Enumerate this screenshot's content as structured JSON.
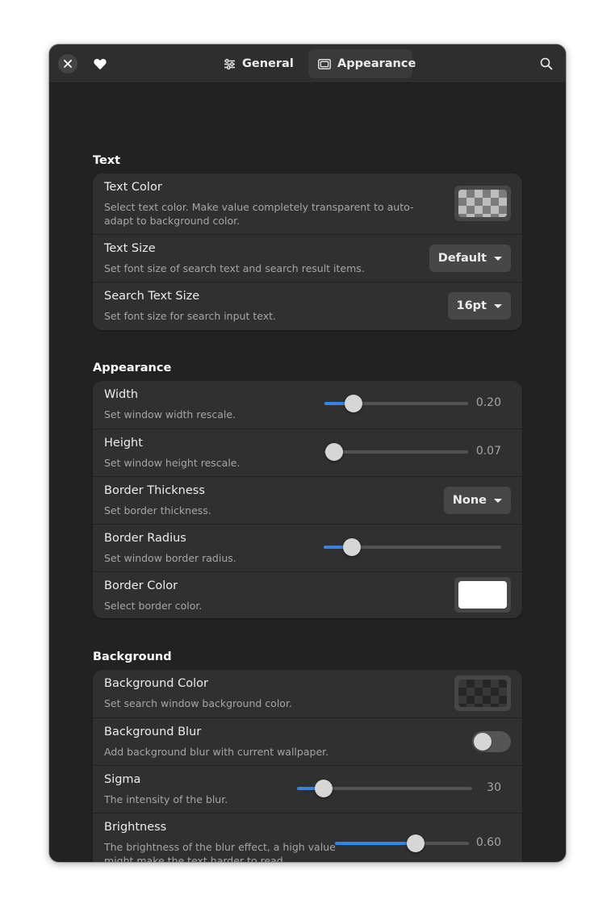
{
  "header": {
    "tabs": [
      {
        "label": "General",
        "icon": "sliders-icon",
        "active": false
      },
      {
        "label": "Appearance",
        "icon": "window-icon",
        "active": true
      }
    ],
    "close_icon": "close-icon",
    "favorite_icon": "heart-icon",
    "search_icon": "search-icon"
  },
  "text_section": {
    "title": "Text",
    "rows": [
      {
        "title": "Text Color",
        "subtitle": "Select text color. Make value completely transparent to auto-adapt to background color.",
        "swatch": "transparent"
      },
      {
        "title": "Text Size",
        "subtitle": "Set font size of search text and search result items.",
        "value": "Default"
      },
      {
        "title": "Search Text Size",
        "subtitle": "Set font size for search input text.",
        "value": "16pt"
      }
    ]
  },
  "appearance_section": {
    "title": "Appearance",
    "rows": [
      {
        "title": "Width",
        "subtitle": "Set window width rescale.",
        "value_label": "0.20",
        "fraction": 0.2
      },
      {
        "title": "Height",
        "subtitle": "Set window height rescale.",
        "value_label": "0.07",
        "fraction": 0.07
      },
      {
        "title": "Border Thickness",
        "subtitle": "Set border thickness.",
        "value": "None"
      },
      {
        "title": "Border Radius",
        "subtitle": "Set window border radius.",
        "fraction": 0.16
      },
      {
        "title": "Border Color",
        "subtitle": "Select border color.",
        "swatch": "#ffffff"
      }
    ]
  },
  "background_section": {
    "title": "Background",
    "rows": [
      {
        "title": "Background Color",
        "subtitle": "Set search window background color.",
        "swatch": "transparent-dark"
      },
      {
        "title": "Background Blur",
        "subtitle": "Add background blur with current wallpaper.",
        "enabled": false
      },
      {
        "title": "Sigma",
        "subtitle": "The intensity of the blur.",
        "value_label": "30",
        "fraction": 0.15
      },
      {
        "title": "Brightness",
        "subtitle": "The brightness of the blur effect, a high value might make the text harder to read.",
        "value_label": "0.60",
        "fraction": 0.6
      }
    ]
  },
  "colors": {
    "window_bg": "#222222",
    "card_bg": "#303030",
    "accent": "#3584e4",
    "headerbar_bg": "#2e2e2e"
  }
}
